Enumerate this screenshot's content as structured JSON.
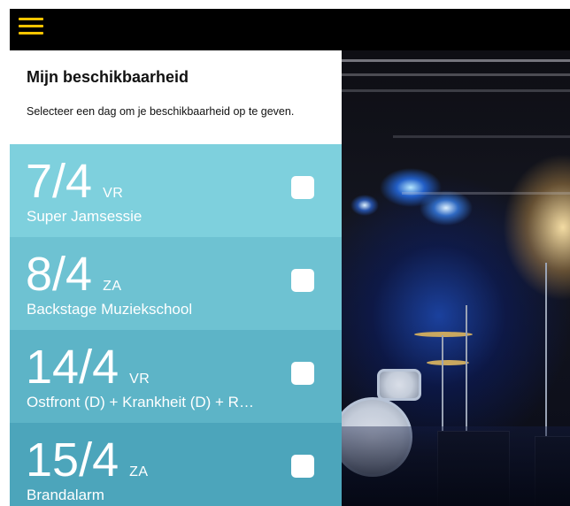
{
  "header": {
    "menu_icon": "hamburger-menu-icon",
    "accent_color": "#ffc400"
  },
  "panel": {
    "title": "Mijn beschikbaarheid",
    "subtitle": "Selecteer een dag om je beschikbaarheid op te geven."
  },
  "days": [
    {
      "date": "7/4",
      "weekday": "VR",
      "event": "Super Jamsessie",
      "checked": false,
      "color": "#7ed0dd"
    },
    {
      "date": "8/4",
      "weekday": "ZA",
      "event": "Backstage Muziekschool",
      "checked": false,
      "color": "#6ec2d2"
    },
    {
      "date": "14/4",
      "weekday": "VR",
      "event": "Ostfront (D) + Krankheit (D) + R…",
      "checked": false,
      "color": "#5db4c7"
    },
    {
      "date": "15/4",
      "weekday": "ZA",
      "event": "Brandalarm",
      "checked": false,
      "color": "#4ca5bb"
    }
  ]
}
